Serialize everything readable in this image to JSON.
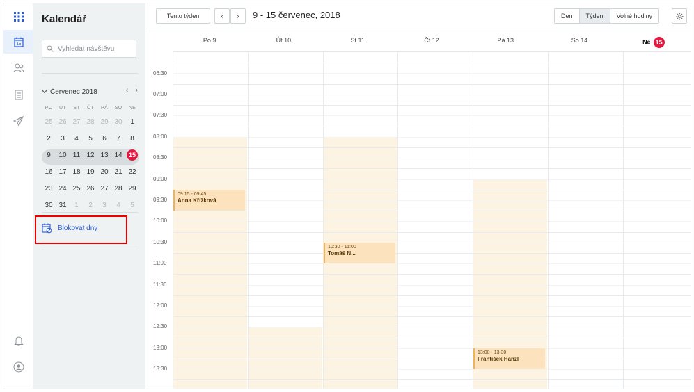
{
  "sidebar": {
    "title": "Kalendář",
    "search_placeholder": "Vyhledat návštěvu",
    "month_title": "Červenec 2018",
    "weekdays": [
      "PO",
      "ÚT",
      "ST",
      "ČT",
      "PÁ",
      "SO",
      "NE"
    ],
    "weeks": [
      [
        "25",
        "26",
        "27",
        "28",
        "29",
        "30",
        "1"
      ],
      [
        "2",
        "3",
        "4",
        "5",
        "6",
        "7",
        "8"
      ],
      [
        "9",
        "10",
        "11",
        "12",
        "13",
        "14",
        "15"
      ],
      [
        "16",
        "17",
        "18",
        "19",
        "20",
        "21",
        "22"
      ],
      [
        "23",
        "24",
        "25",
        "26",
        "27",
        "28",
        "29"
      ],
      [
        "30",
        "31",
        "1",
        "2",
        "3",
        "4",
        "5"
      ]
    ],
    "block_days_label": "Blokovat dny"
  },
  "toolbar": {
    "this_week": "Tento týden",
    "range_title": "9 - 15 červenec, 2018",
    "views": [
      "Den",
      "Týden",
      "Volné hodiny"
    ],
    "active_view": "Týden"
  },
  "days": [
    {
      "label": "Po 9"
    },
    {
      "label": "Út 10"
    },
    {
      "label": "St 11"
    },
    {
      "label": "Čt 12"
    },
    {
      "label": "Pá 13"
    },
    {
      "label": "So 14"
    },
    {
      "label": "Ne",
      "badge": "15"
    }
  ],
  "times": [
    "06:30",
    "07:00",
    "07:30",
    "08:00",
    "08:30",
    "09:00",
    "09:30",
    "10:00",
    "10:30",
    "11:00",
    "11:30",
    "12:00",
    "12:30",
    "13:00",
    "13:30"
  ],
  "events": [
    {
      "time": "09:15 - 09:45",
      "name": "Anna Křížková"
    },
    {
      "time": "10:30 - 11:00",
      "name": "Tomáš N..."
    },
    {
      "time": "13:00 - 13:30",
      "name": "František Hanzl"
    }
  ],
  "colors": {
    "accent": "#2a5bd7",
    "today": "#e5183f",
    "available": "#fdf3e3",
    "event": "#fde3bd"
  }
}
